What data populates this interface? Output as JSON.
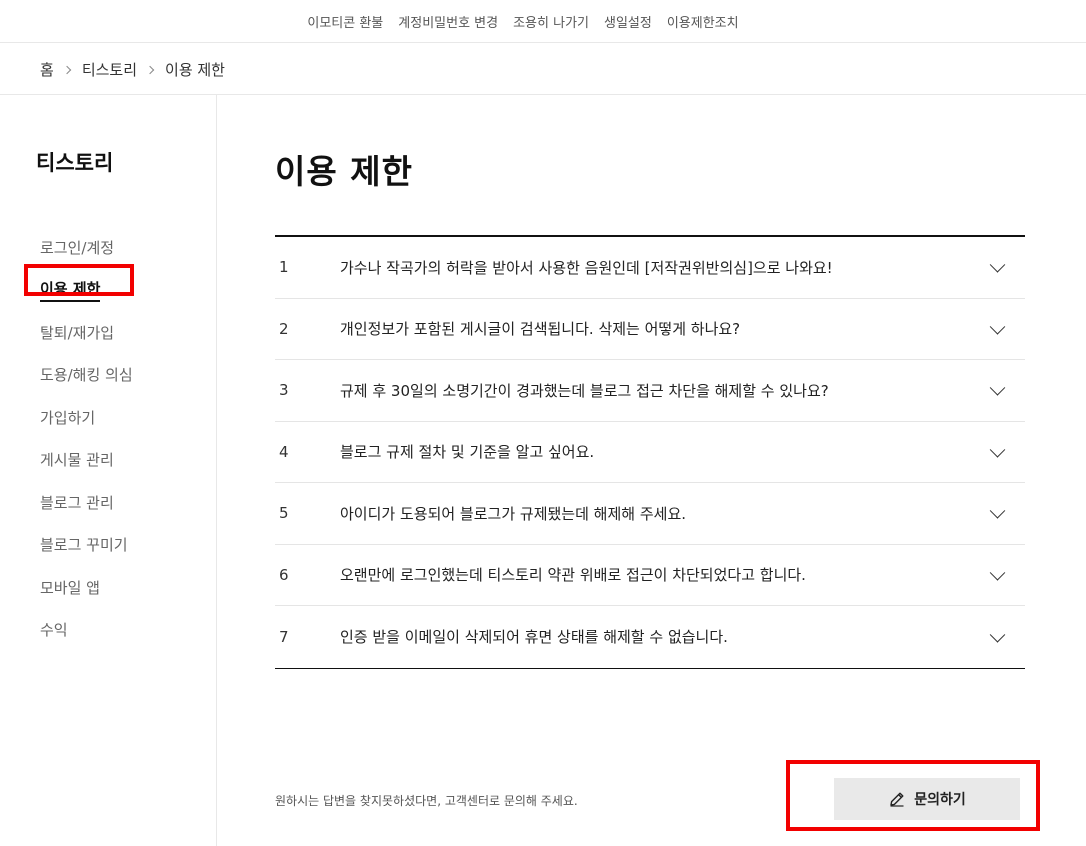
{
  "top_links": [
    "이모티콘 환불",
    "계정비밀번호 변경",
    "조용히 나가기",
    "생일설정",
    "이용제한조치"
  ],
  "breadcrumb": {
    "home": "홈",
    "section": "티스토리",
    "current": "이용 제한"
  },
  "sidebar": {
    "title": "티스토리",
    "items": [
      {
        "label": "로그인/계정",
        "active": false
      },
      {
        "label": "이용 제한",
        "active": true
      },
      {
        "label": "탈퇴/재가입",
        "active": false
      },
      {
        "label": "도용/해킹 의심",
        "active": false
      },
      {
        "label": "가입하기",
        "active": false
      },
      {
        "label": "게시물 관리",
        "active": false
      },
      {
        "label": "블로그 관리",
        "active": false
      },
      {
        "label": "블로그 꾸미기",
        "active": false
      },
      {
        "label": "모바일 앱",
        "active": false
      },
      {
        "label": "수익",
        "active": false
      }
    ]
  },
  "main": {
    "title": "이용 제한",
    "faqs": [
      {
        "num": "1",
        "question": "가수나 작곡가의 허락을 받아서 사용한 음원인데 [저작권위반의심]으로 나와요!"
      },
      {
        "num": "2",
        "question": "개인정보가 포함된 게시글이 검색됩니다. 삭제는 어떻게 하나요?"
      },
      {
        "num": "3",
        "question": "규제 후 30일의 소명기간이 경과했는데 블로그 접근 차단을 해제할 수 있나요?"
      },
      {
        "num": "4",
        "question": "블로그 규제 절차 및 기준을 알고 싶어요."
      },
      {
        "num": "5",
        "question": "아이디가 도용되어 블로그가 규제됐는데 해제해 주세요."
      },
      {
        "num": "6",
        "question": "오랜만에 로그인했는데 티스토리 약관 위배로 접근이 차단되었다고 합니다."
      },
      {
        "num": "7",
        "question": "인증 받을 이메일이 삭제되어 휴면 상태를 해제할 수 없습니다."
      }
    ],
    "help_text": "원하시는 답변을 찾지못하셨다면, 고객센터로 문의해 주세요.",
    "inquiry_label": "문의하기",
    "inquiry_icon": "pencil-icon"
  },
  "colors": {
    "highlight": "#f20000",
    "button_bg": "#e9e9e9"
  }
}
